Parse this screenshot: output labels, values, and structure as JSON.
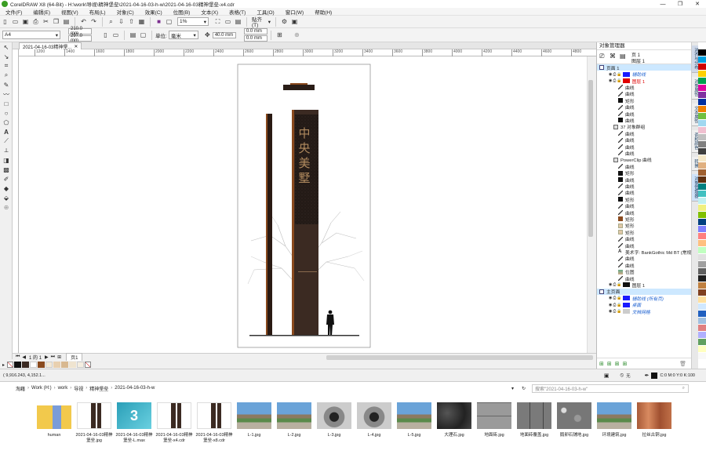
{
  "window": {
    "title": "CorelDRAW X8 (64-Bit) - H:\\work\\导视\\精神堡垒\\2021-04-16-03-h-w\\2021-04-16-03精神堡垒-x4.cdr",
    "minimize": "—",
    "restore": "❐",
    "close": "✕"
  },
  "menu": [
    "文件(F)",
    "编辑(E)",
    "视图(V)",
    "布局(L)",
    "对象(C)",
    "效果(C)",
    "位图(B)",
    "文本(X)",
    "表格(T)",
    "工具(O)",
    "窗口(W)",
    "帮助(H)"
  ],
  "standard_bar": {
    "zoom": "1%",
    "snap_label": "贴齐(T)"
  },
  "property_bar": {
    "page_size": "A4",
    "width": "210.0 mm",
    "height": "297.0 mm",
    "units_label": "单位:",
    "units": "毫米",
    "nudge": "40.0 mm",
    "dup_x": "0.0 mm",
    "dup_y": "0.0 mm"
  },
  "document_tab": {
    "label": "2021-04-16-03精神堡...",
    "close": "✕"
  },
  "ruler_ticks": [
    "1200",
    "1400",
    "1600",
    "1800",
    "2000",
    "2200",
    "2400",
    "2600",
    "2800",
    "3000",
    "3200",
    "3400",
    "3600",
    "3800",
    "4000",
    "4200",
    "4400",
    "4600",
    "4800"
  ],
  "artwork": {
    "sign_text": [
      "中",
      "央",
      "美",
      "墅"
    ],
    "sign_color": "#3b2a22",
    "text_color": "#b08a5e",
    "accent": "#8a4a1e"
  },
  "page_nav": {
    "counter": "1 的 1",
    "page_tab": "页1"
  },
  "status": {
    "coords": "( 9,916.243, 4,152.1...",
    "fill": "无",
    "color_info": "C:0 M:0 Y:0 K:100"
  },
  "object_manager": {
    "title": "对象管理器",
    "header": [
      "页 1",
      "图层 1"
    ],
    "rows": [
      {
        "label": "页面 1",
        "indent": 0,
        "icon": "page",
        "sel": true
      },
      {
        "label": "辅助线",
        "indent": 2,
        "icon": "layer",
        "color": "#1a1aff",
        "italic": true
      },
      {
        "label": "图层 1",
        "indent": 2,
        "icon": "layer",
        "color": "#e00000",
        "red": true
      },
      {
        "label": "曲线",
        "indent": 4,
        "icon": "curve"
      },
      {
        "label": "曲线",
        "indent": 4,
        "icon": "curve"
      },
      {
        "label": "矩形",
        "indent": 4,
        "icon": "black"
      },
      {
        "label": "曲线",
        "indent": 4,
        "icon": "curve"
      },
      {
        "label": "曲线",
        "indent": 4,
        "icon": "curve"
      },
      {
        "label": "曲线",
        "indent": 4,
        "icon": "black"
      },
      {
        "label": "37 对象群组",
        "indent": 3,
        "icon": "group"
      },
      {
        "label": "曲线",
        "indent": 4,
        "icon": "curve"
      },
      {
        "label": "曲线",
        "indent": 4,
        "icon": "curve"
      },
      {
        "label": "曲线",
        "indent": 4,
        "icon": "curve"
      },
      {
        "label": "曲线",
        "indent": 4,
        "icon": "curve"
      },
      {
        "label": "PowerClip 曲线",
        "indent": 3,
        "icon": "group"
      },
      {
        "label": "曲线",
        "indent": 4,
        "icon": "curve"
      },
      {
        "label": "矩形",
        "indent": 4,
        "icon": "black"
      },
      {
        "label": "曲线",
        "indent": 4,
        "icon": "black"
      },
      {
        "label": "曲线",
        "indent": 4,
        "icon": "curve"
      },
      {
        "label": "曲线",
        "indent": 4,
        "icon": "curve"
      },
      {
        "label": "矩形",
        "indent": 4,
        "icon": "black"
      },
      {
        "label": "曲线",
        "indent": 4,
        "icon": "curve"
      },
      {
        "label": "曲线",
        "indent": 4,
        "icon": "curve"
      },
      {
        "label": "矩形",
        "indent": 4,
        "icon": "brown"
      },
      {
        "label": "矩形",
        "indent": 4,
        "icon": "tan"
      },
      {
        "label": "矩形",
        "indent": 4,
        "icon": "tan"
      },
      {
        "label": "曲线",
        "indent": 4,
        "icon": "curve"
      },
      {
        "label": "曲线",
        "indent": 4,
        "icon": "curve"
      },
      {
        "label": "美术字: BankGothic Md BT (常规) (...",
        "indent": 4,
        "icon": "text"
      },
      {
        "label": "曲线",
        "indent": 4,
        "icon": "curve"
      },
      {
        "label": "曲线",
        "indent": 4,
        "icon": "curve"
      },
      {
        "label": "位图",
        "indent": 4,
        "icon": "bitmap"
      },
      {
        "label": "曲线",
        "indent": 4,
        "icon": "curve"
      },
      {
        "label": "图层 1",
        "indent": 2,
        "icon": "layer",
        "color": "#111111"
      },
      {
        "label": "主页面",
        "indent": 0,
        "icon": "page",
        "sel": true
      },
      {
        "label": "辅助线 (所有页)",
        "indent": 2,
        "icon": "layer",
        "color": "#1a1aff",
        "italic": true
      },
      {
        "label": "桌面",
        "indent": 2,
        "icon": "layer",
        "color": "#1a1aff",
        "italic": true
      },
      {
        "label": "文档网格",
        "indent": 2,
        "icon": "layer",
        "color": "#cccccc",
        "italic": true
      }
    ]
  },
  "docker_tabs": [
    "对齐与分布",
    "对象属性",
    "文本属性",
    "调和颜色",
    "转换",
    "对象管理器"
  ],
  "explorer": {
    "breadcrumb": [
      "淘藉",
      "Work (H:)",
      "work",
      "导视",
      "精神堡垒",
      "2021-04-16-03-h-w"
    ],
    "search_placeholder": "搜索\"2021-04-16-03-h-w\"",
    "files": [
      {
        "name": "human",
        "type": "folder"
      },
      {
        "name": "2021-04-16-03精神堡垒.jpg",
        "type": "sign"
      },
      {
        "name": "2021-04-16-03精神堡垒-L.max",
        "type": "max"
      },
      {
        "name": "2021-04-16-03精神堡垒-x4.cdr",
        "type": "cdr"
      },
      {
        "name": "2021-04-16-03精神堡垒-x8.cdr",
        "type": "cdr"
      },
      {
        "name": "L-1.jpg",
        "type": "photo"
      },
      {
        "name": "L-2.jpg",
        "type": "photo"
      },
      {
        "name": "L-3.jpg",
        "type": "closeup"
      },
      {
        "name": "L-4.jpg",
        "type": "closeup"
      },
      {
        "name": "L-5.jpg",
        "type": "photo"
      },
      {
        "name": "大理石.jpg",
        "type": "marble"
      },
      {
        "name": "地面砖.jpg",
        "type": "tile"
      },
      {
        "name": "地面砖覆盖.jpg",
        "type": "tile2"
      },
      {
        "name": "鹅卵石铺地.jpg",
        "type": "pebble"
      },
      {
        "name": "环境建筑.jpg",
        "type": "photo"
      },
      {
        "name": "拉丝古铜.jpg",
        "type": "bronze"
      }
    ]
  },
  "colors": {
    "accent": "#1e6fd0",
    "selected_row": "#cde8ff"
  }
}
